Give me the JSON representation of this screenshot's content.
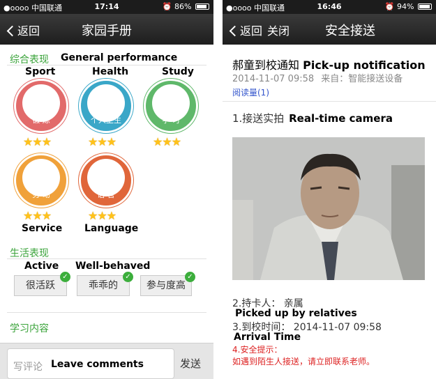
{
  "left": {
    "status": {
      "carrier": "●oooo 中国联通",
      "time": "17:14",
      "battery_text": "86%",
      "battery_level": 0.86
    },
    "nav": {
      "back": "返回",
      "title": "家园手册"
    },
    "general": {
      "cn": "综合表现",
      "en": "General performance"
    },
    "badges": [
      {
        "en": "Sport",
        "cn": "锻 炼",
        "color": "#e26a6a",
        "stars": 3
      },
      {
        "en": "Health",
        "cn": "个人卫生",
        "color": "#3aa7c8",
        "stars": 3
      },
      {
        "en": "Study",
        "cn": "学 习",
        "color": "#5fb86a",
        "stars": 3
      },
      {
        "en": "Service",
        "cn": "劳 动",
        "color": "#f0a13a",
        "stars": 3
      },
      {
        "en": "Language",
        "cn": "语 言",
        "color": "#e0663a",
        "stars": 3
      }
    ],
    "life": {
      "cn": "生活表现",
      "en_active": "Active",
      "en_behaved": "Well-behaved",
      "tags": [
        "很活跃",
        "乖乖的",
        "参与度高"
      ]
    },
    "study_content": "学习内容",
    "comment": {
      "placeholder": "写评论",
      "en": "Leave comments",
      "send": "发送"
    }
  },
  "right": {
    "status": {
      "carrier": "●oooo 中国联通",
      "time": "16:46",
      "battery_text": "94%",
      "battery_level": 0.94
    },
    "nav": {
      "back": "返回",
      "close": "关闭",
      "title": "安全接送"
    },
    "headline_cn": "郝童到校通知",
    "headline_en": "Pick-up notification",
    "date": "2014-11-07 09:58",
    "source": "来自：智能接送设备",
    "read_count": "阅读量(1)",
    "item1_cn": "1.接送实拍",
    "item1_en": "Real-time camera",
    "item2_cn": "2.持卡人：  亲属",
    "item2_en": "Picked up by relatives",
    "item3_cn": "3.到校时间：   2014-11-07 09:58",
    "item3_en": "Arrival Time",
    "item4_cn": "4.安全提示：",
    "item4_text": "如遇到陌生人接送，请立即联系老师。"
  }
}
